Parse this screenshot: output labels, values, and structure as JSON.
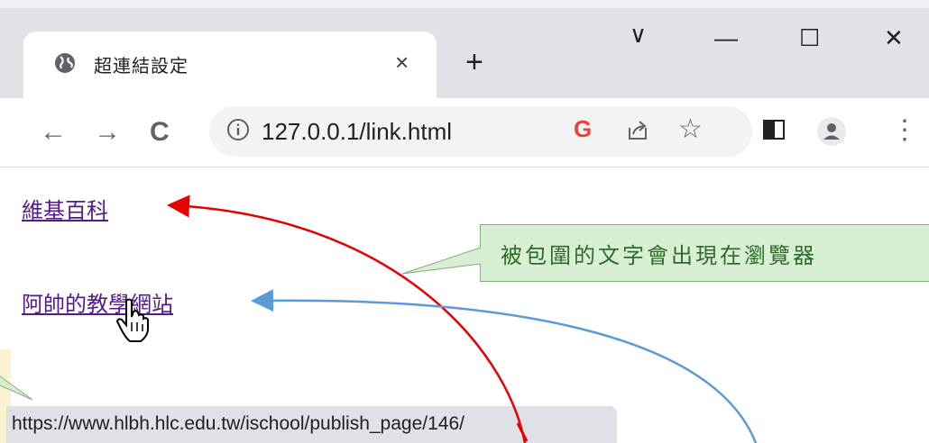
{
  "browser": {
    "tab": {
      "title": "超連結設定",
      "close": "×",
      "globe_icon": "globe-icon"
    },
    "new_tab": "+",
    "window_controls": {
      "tab_search": "∨",
      "minimize": "—",
      "maximize": "☐",
      "close": "✕"
    },
    "toolbar": {
      "back": "←",
      "forward": "→",
      "reload": "C",
      "url": "127.0.0.1/link.html",
      "google_icon": "G",
      "bookmark": "☆",
      "menu": "⋮"
    }
  },
  "page": {
    "links": [
      {
        "label": "維基百科"
      },
      {
        "label": "阿帥的教學網站"
      }
    ]
  },
  "callout": {
    "text": "被包圍的文字會出現在瀏覽器"
  },
  "status_bar": {
    "url": "https://www.hlbh.hlc.edu.tw/ischool/publish_page/146/"
  },
  "colors": {
    "arrow_red": "#e60000",
    "arrow_blue": "#5b9bd5",
    "callout_bg": "#d9efd3",
    "link": "#551a8b"
  }
}
